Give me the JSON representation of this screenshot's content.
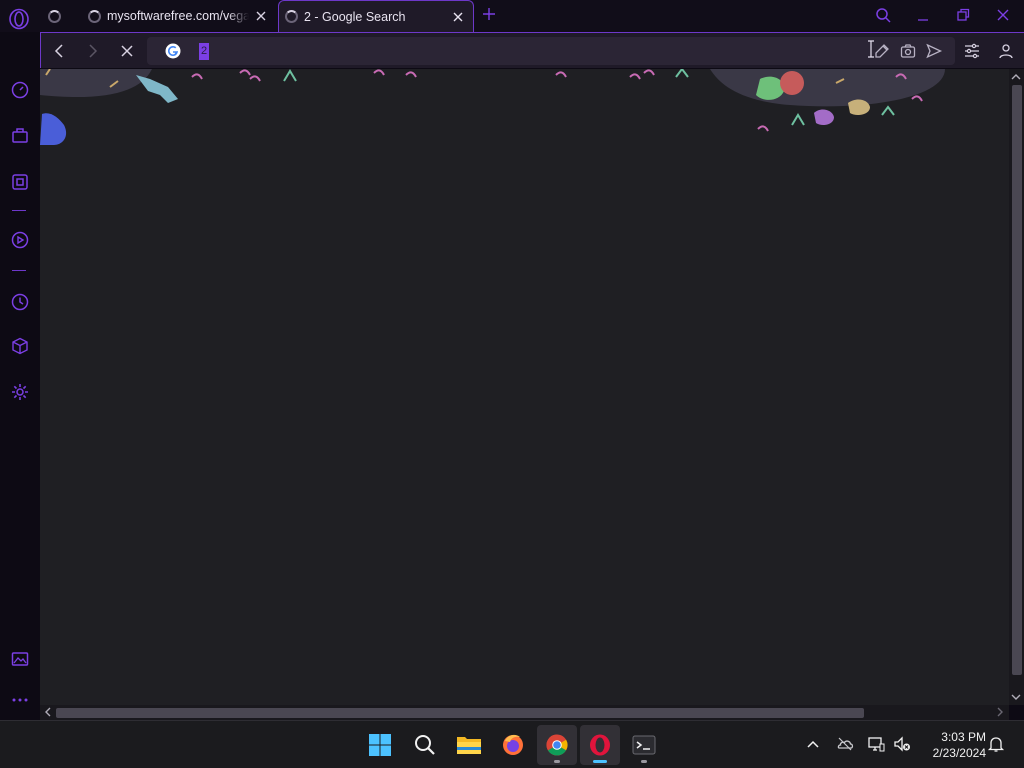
{
  "tabs": [
    {
      "title": "",
      "loading": true
    },
    {
      "title": "mysoftwarefree.com/vegas",
      "loading": true
    },
    {
      "title": "2 - Google Search",
      "loading": true,
      "active": true
    }
  ],
  "address_bar": {
    "value": "2",
    "engine_icon": "google-icon"
  },
  "colors": {
    "accent": "#6d38c9",
    "page_bg": "#1f1f23",
    "taskbar_bg": "#1b1b1e"
  },
  "sidebar_icons": [
    "speed-dial-icon",
    "shopping-icon",
    "extensions-icon",
    "player-icon",
    "history-icon",
    "box-icon",
    "settings-icon",
    "gallery-icon",
    "more-icon"
  ],
  "taskbar": {
    "apps": [
      "windows-start-icon",
      "search-icon",
      "file-explorer-icon",
      "firefox-icon",
      "chrome-icon",
      "opera-icon",
      "terminal-icon"
    ]
  },
  "clock": {
    "time": "3:03 PM",
    "date": "2/23/2024"
  }
}
